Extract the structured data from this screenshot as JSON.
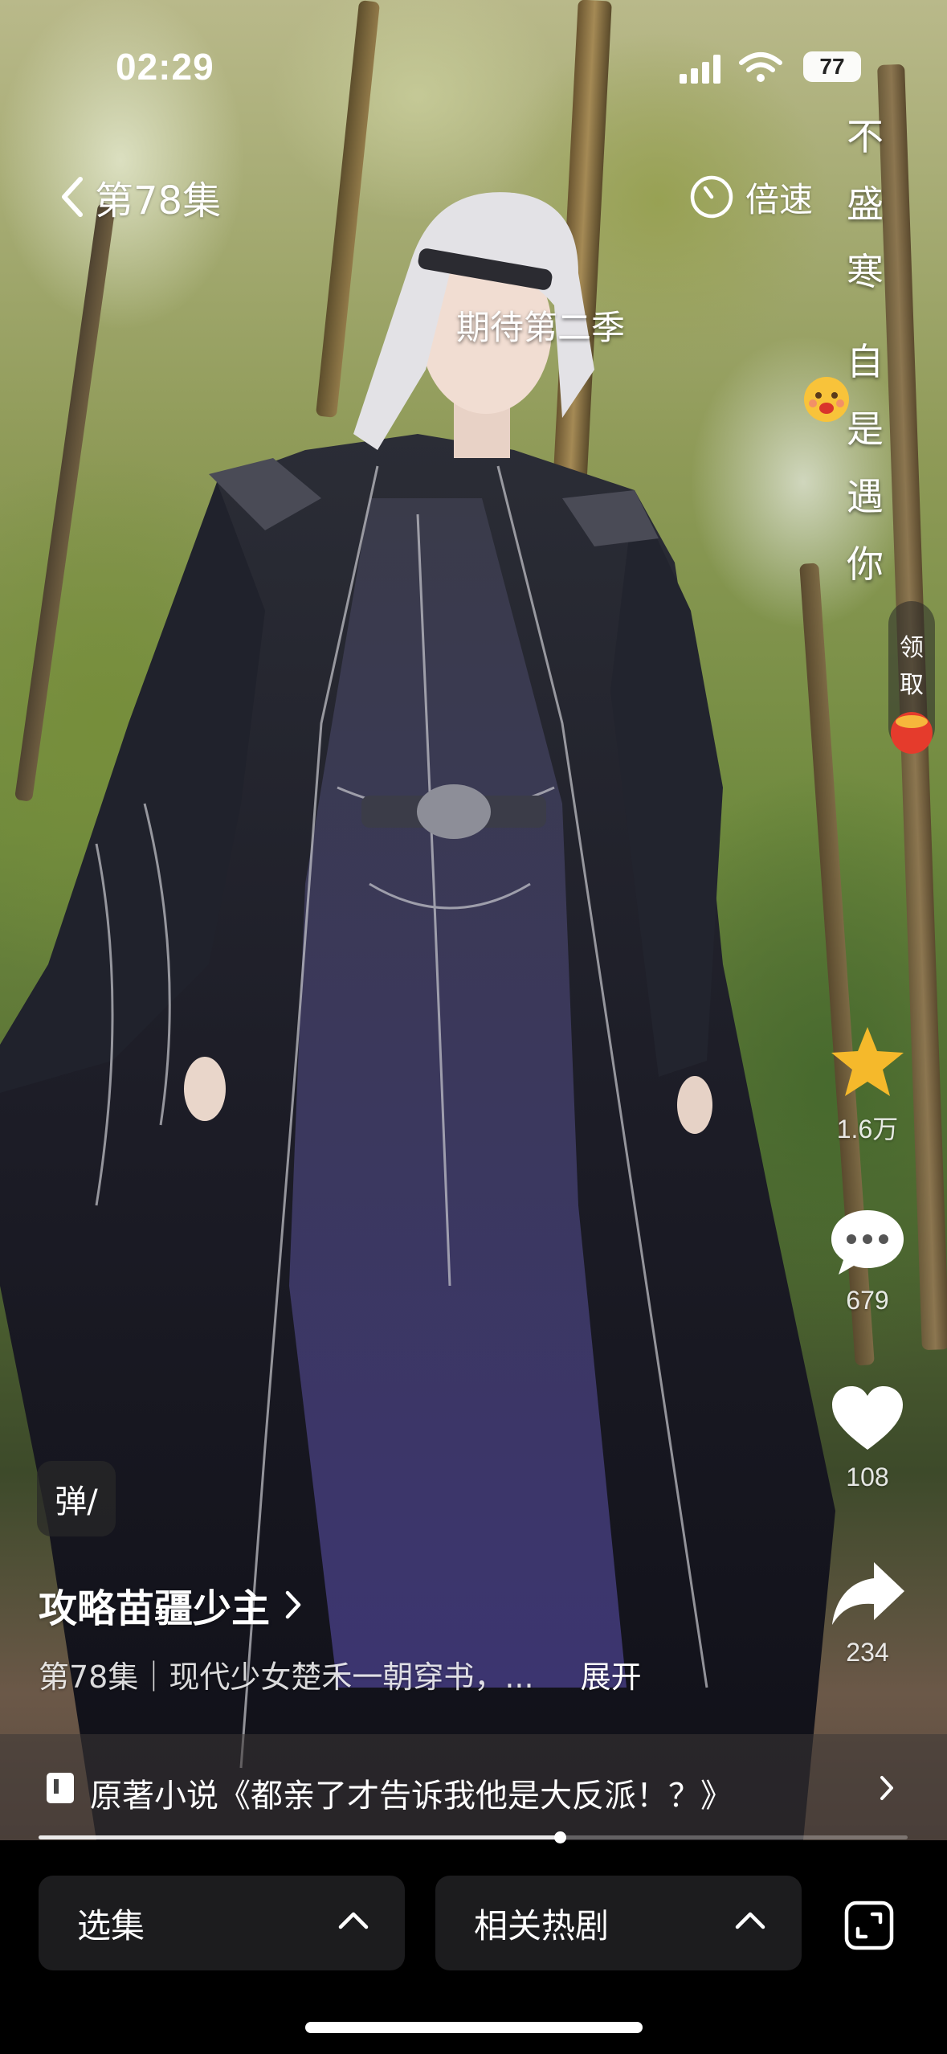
{
  "status": {
    "time": "02:29",
    "battery": "77"
  },
  "header": {
    "episode_label": "第78集",
    "speed_label": "倍速"
  },
  "danmaku": {
    "floating": "期待第二季",
    "vertical_top": [
      "不",
      "盛",
      "寒"
    ],
    "vertical_bottom": [
      "自",
      "是",
      "遇",
      "你"
    ]
  },
  "reward_pill": {
    "label": "领取"
  },
  "actions": {
    "favorite_count": "1.6万",
    "comment_count": "679",
    "like_count": "108",
    "share_count": "234"
  },
  "info": {
    "danmu_toggle": "弹/",
    "show_title": "攻略苗疆少主",
    "description": "第78集｜现代少女楚禾一朝穿书，...",
    "expand_label": "展开",
    "novel_banner": "原著小说《都亲了才告诉我他是大反派！？》"
  },
  "playback": {
    "progress_fraction": 0.6
  },
  "bottom_bar": {
    "episodes_label": "选集",
    "related_label": "相关热剧"
  },
  "colors": {
    "star": "#f5b92b",
    "panel": "#1c1c1e",
    "background": "#000000"
  },
  "icons": [
    "back-chevron-icon",
    "speed-timer-icon",
    "star-icon",
    "comment-icon",
    "heart-icon",
    "share-icon",
    "book-icon",
    "chevron-up-icon",
    "fullscreen-icon",
    "signal-icon",
    "wifi-icon"
  ]
}
